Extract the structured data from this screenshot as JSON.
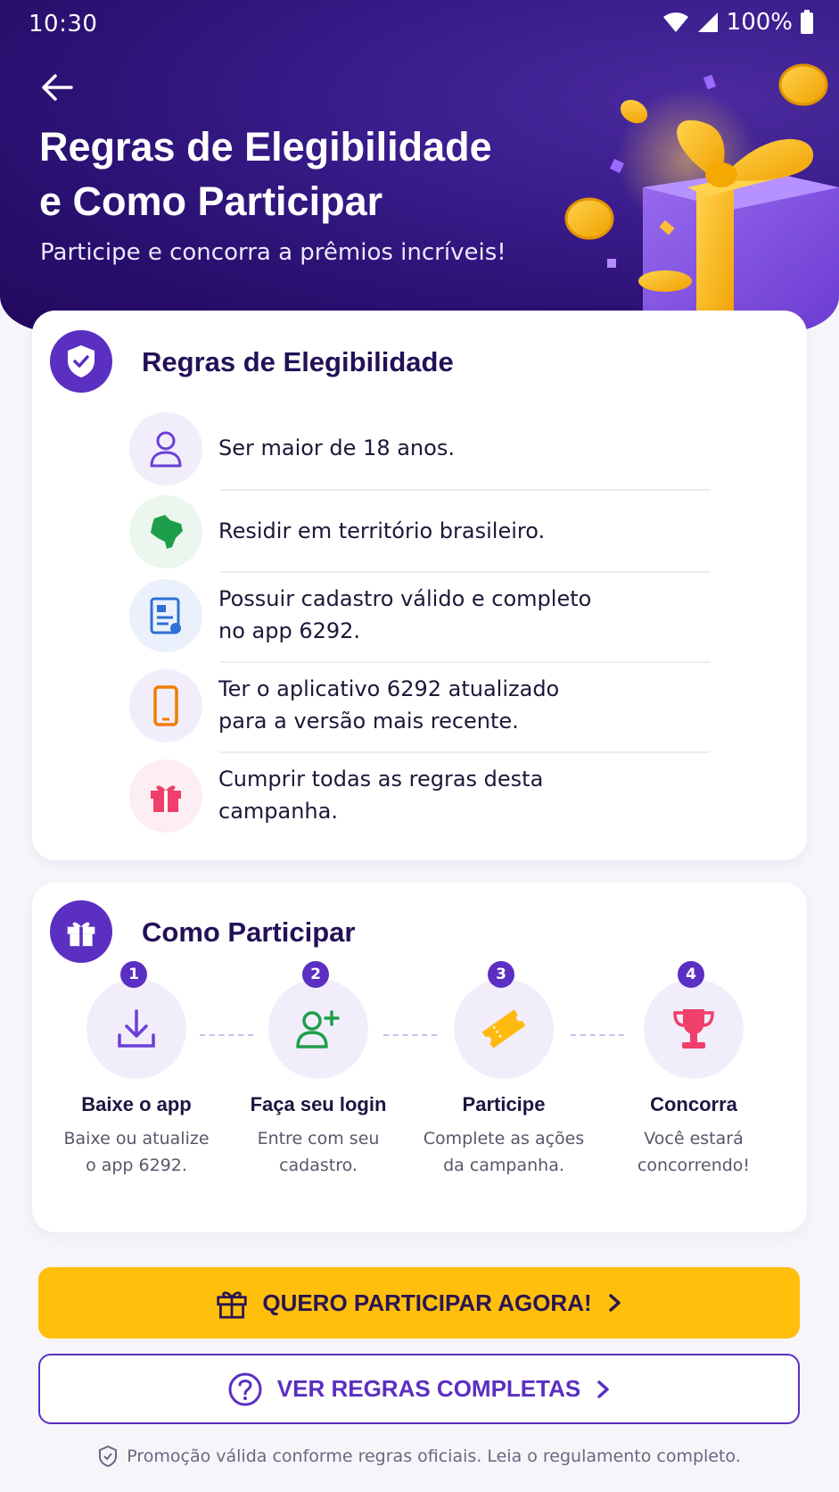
{
  "status_bar": {
    "time": "10:30",
    "battery": "100%"
  },
  "header": {
    "title_line1": "Regras de Elegibilidade",
    "title_line2": "e Como Participar",
    "subtitle": "Participe e concorra a prêmios incríveis!"
  },
  "eligibility": {
    "title": "Regras de Elegibilidade",
    "rules": [
      {
        "line1": "Ser maior de 18 anos.",
        "line2": "",
        "icon": "person-icon"
      },
      {
        "line1": "Residir em território brasileiro.",
        "line2": "",
        "icon": "brazil-map-icon"
      },
      {
        "line1": "Possuir cadastro válido e completo",
        "line2": "no app 6292.",
        "icon": "document-icon"
      },
      {
        "line1": "Ter o aplicativo 6292 atualizado",
        "line2": "para a versão mais recente.",
        "icon": "phone-icon"
      },
      {
        "line1": "Cumprir todas as regras desta",
        "line2": "campanha.",
        "icon": "gift-icon"
      }
    ]
  },
  "how_to": {
    "title": "Como Participar",
    "steps": [
      {
        "num": "1",
        "title": "Baixe o app",
        "desc1": "Baixe ou atualize",
        "desc2": "o app 6292.",
        "icon": "download-icon"
      },
      {
        "num": "2",
        "title": "Faça seu login",
        "desc1": "Entre com seu",
        "desc2": "cadastro.",
        "icon": "add-user-icon"
      },
      {
        "num": "3",
        "title": "Participe",
        "desc1": "Complete as ações",
        "desc2": "da campanha.",
        "icon": "ticket-icon"
      },
      {
        "num": "4",
        "title": "Concorra",
        "desc1": "Você estará",
        "desc2": "concorrendo!",
        "icon": "trophy-icon"
      }
    ]
  },
  "actions": {
    "primary_label": "QUERO PARTICIPAR AGORA!",
    "secondary_label": "VER REGRAS COMPLETAS"
  },
  "footer": {
    "note": "Promoção válida conforme regras oficiais. Leia o regulamento completo."
  },
  "colors": {
    "primary": "#5a2fc2",
    "accent": "#ffbf0a",
    "header_bg": "#2a1070"
  }
}
